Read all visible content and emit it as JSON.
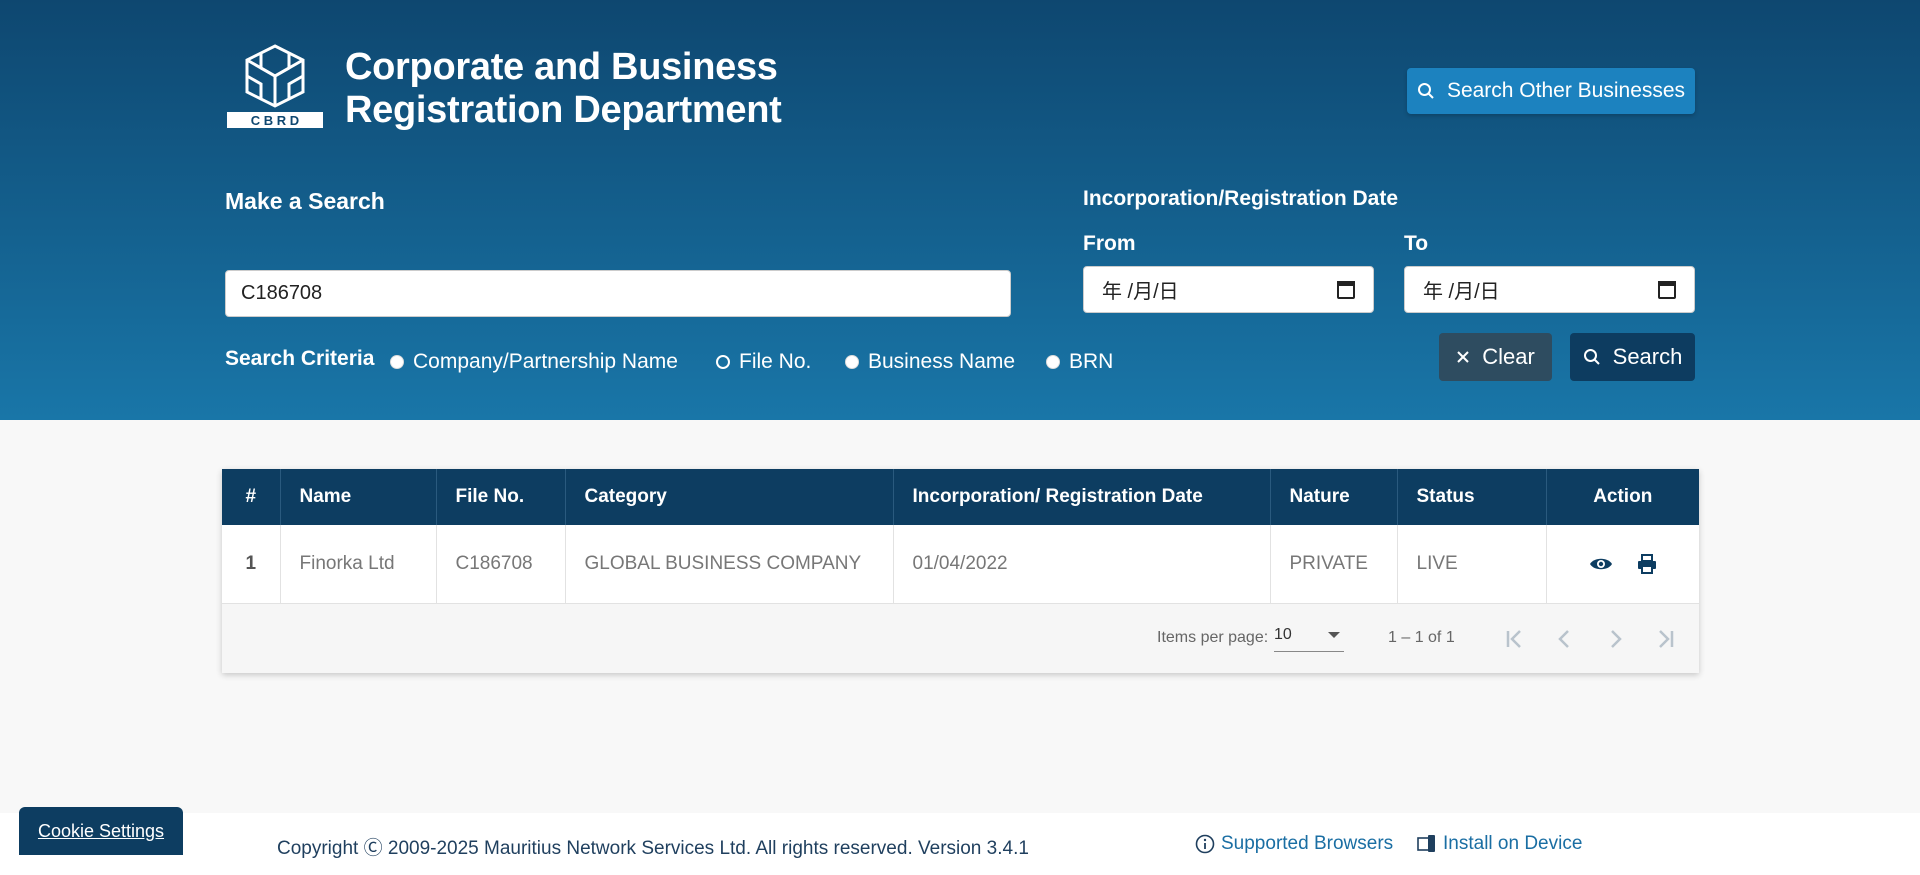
{
  "header": {
    "logo_letters": "C B R D",
    "title_line1": "Corporate and Business",
    "title_line2": "Registration Department",
    "other_search_label": "Search Other Businesses",
    "make_search_label": "Make a Search",
    "search_value": "C186708",
    "criteria_label": "Search Criteria",
    "criteria_options": [
      {
        "label": "Company/Partnership Name",
        "selected": false
      },
      {
        "label": "File No.",
        "selected": true
      },
      {
        "label": "Business Name",
        "selected": false
      },
      {
        "label": "BRN",
        "selected": false
      }
    ],
    "date_label": "Incorporation/Registration Date",
    "from_label": "From",
    "to_label": "To",
    "from_value": "年 /月/日",
    "to_value": "年 /月/日",
    "clear_label": "Clear",
    "search_label": "Search"
  },
  "table": {
    "columns": [
      "#",
      "Name",
      "File No.",
      "Category",
      "Incorporation/ Registration Date",
      "Nature",
      "Status",
      "Action"
    ],
    "rows": [
      {
        "num": "1",
        "name": "Finorka Ltd",
        "file_no": "C186708",
        "category": "GLOBAL BUSINESS COMPANY",
        "date": "01/04/2022",
        "nature": "PRIVATE",
        "status": "LIVE"
      }
    ]
  },
  "paginator": {
    "items_per_page_label": "Items per page:",
    "items_per_page_value": "10",
    "range_label": "1 – 1 of 1"
  },
  "footer": {
    "copyright": "Copyright Ⓒ 2009-2025 Mauritius Network Services Ltd. All rights reserved. Version 3.4.1",
    "supported_browsers": "Supported Browsers",
    "install": "Install on Device",
    "cookie_settings": "Cookie Settings"
  },
  "colors": {
    "header_top": "#0e4770",
    "header_bottom": "#1976a8",
    "table_header": "#0d3d61",
    "link": "#1a6ea3"
  }
}
